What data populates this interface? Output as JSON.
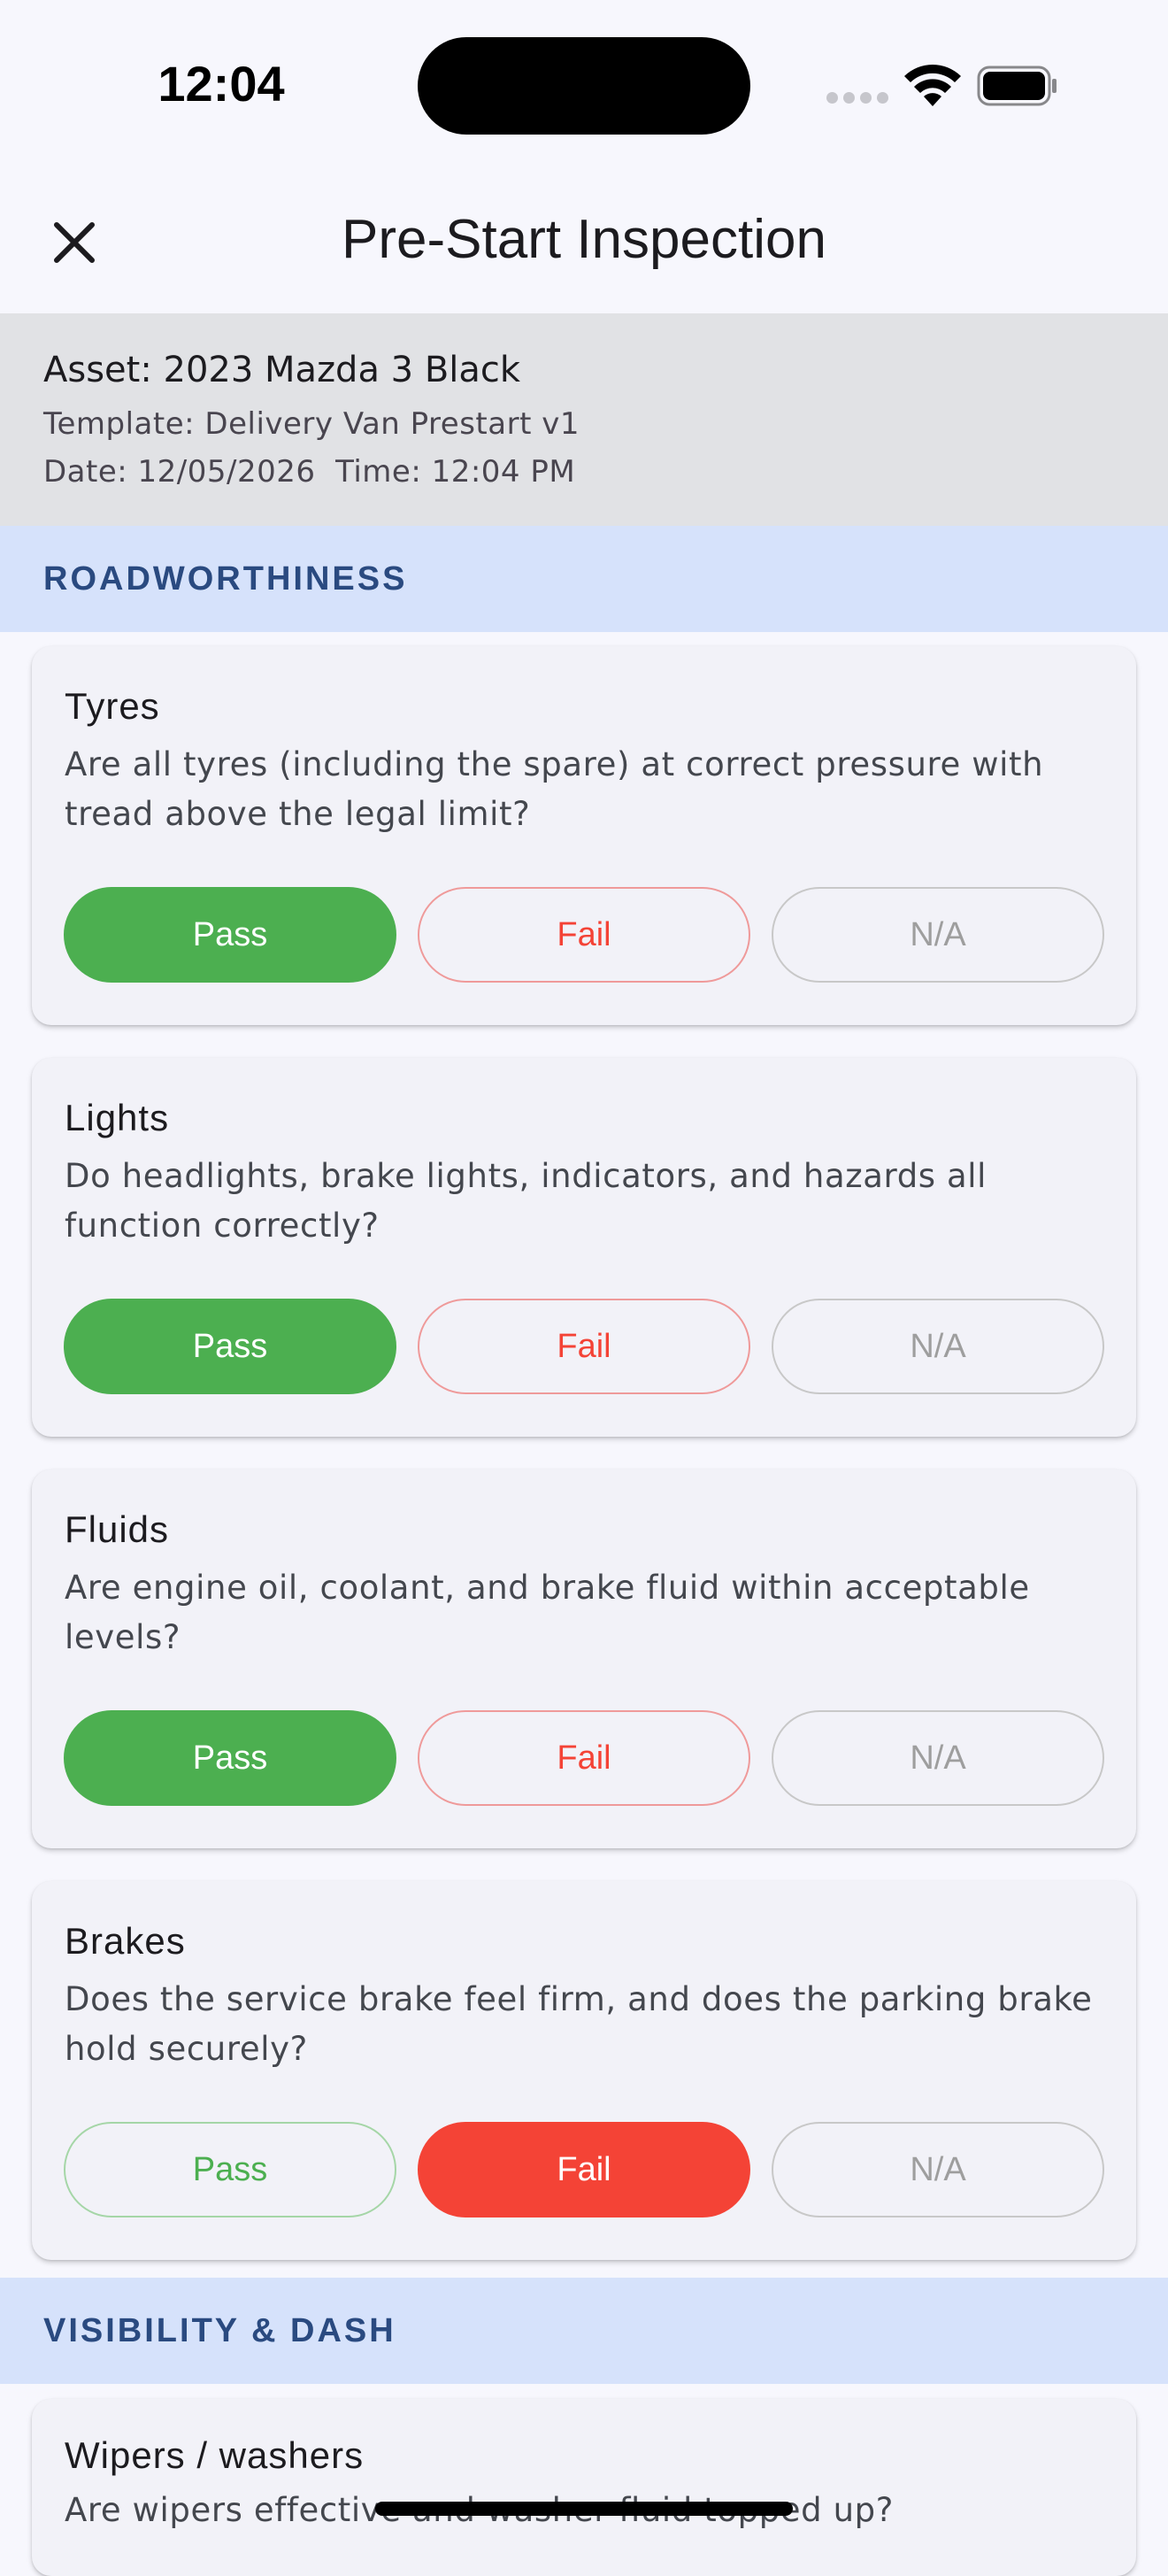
{
  "status_bar": {
    "time": "12:04"
  },
  "app_bar": {
    "title": "Pre-Start Inspection",
    "close_icon": "close-icon"
  },
  "inspection_info": {
    "asset": "Asset: 2023 Mazda 3 Black",
    "template": "Template: Delivery Van Prestart v1",
    "datetime": "Date: 12/05/2026  Time: 12:04 PM"
  },
  "option_labels": {
    "pass": "Pass",
    "fail": "Fail",
    "na": "N/A"
  },
  "sections": [
    {
      "label": "ROADWORTHINESS",
      "items": [
        {
          "title": "Tyres",
          "question": "Are all tyres (including the spare) at correct pressure with tread above the legal limit?",
          "selected": "pass"
        },
        {
          "title": "Lights",
          "question": "Do headlights, brake lights, indicators, and hazards all function correctly?",
          "selected": "pass"
        },
        {
          "title": "Fluids",
          "question": "Are engine oil, coolant, and brake fluid within acceptable levels?",
          "selected": "pass"
        },
        {
          "title": "Brakes",
          "question": "Does the service brake feel firm, and does the parking brake hold securely?",
          "selected": "fail"
        }
      ]
    },
    {
      "label": "VISIBILITY & DASH",
      "items": [
        {
          "title": "Wipers / washers",
          "question": "Are wipers effective and washer fluid topped up?",
          "selected": ""
        }
      ]
    }
  ],
  "colors": {
    "pass": "#4caf50",
    "fail": "#f44336",
    "section_bg": "#d6e2fb",
    "section_text": "#2a4a80"
  }
}
